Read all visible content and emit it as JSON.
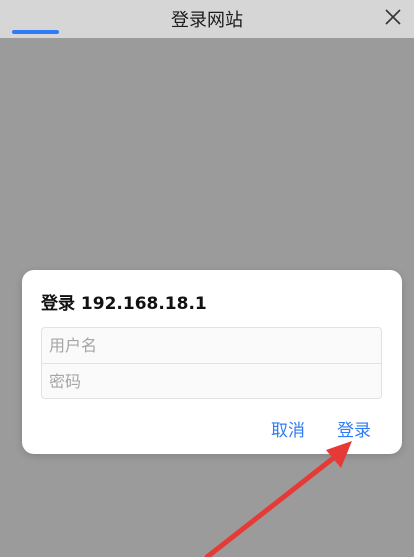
{
  "window": {
    "title": "登录网站",
    "close_icon": "close-icon",
    "load_progress": 0.12
  },
  "dialog": {
    "title": "登录 192.168.18.1",
    "username_placeholder": "用户名",
    "password_placeholder": "密码",
    "cancel_label": "取消",
    "login_label": "登录"
  },
  "annotation": {
    "arrow_icon": "red-arrow-icon",
    "arrow_color": "#e53a36"
  },
  "colors": {
    "accent": "#2f7cf6",
    "backdrop": "#9b9b9b",
    "topbar": "#d6d6d6"
  }
}
